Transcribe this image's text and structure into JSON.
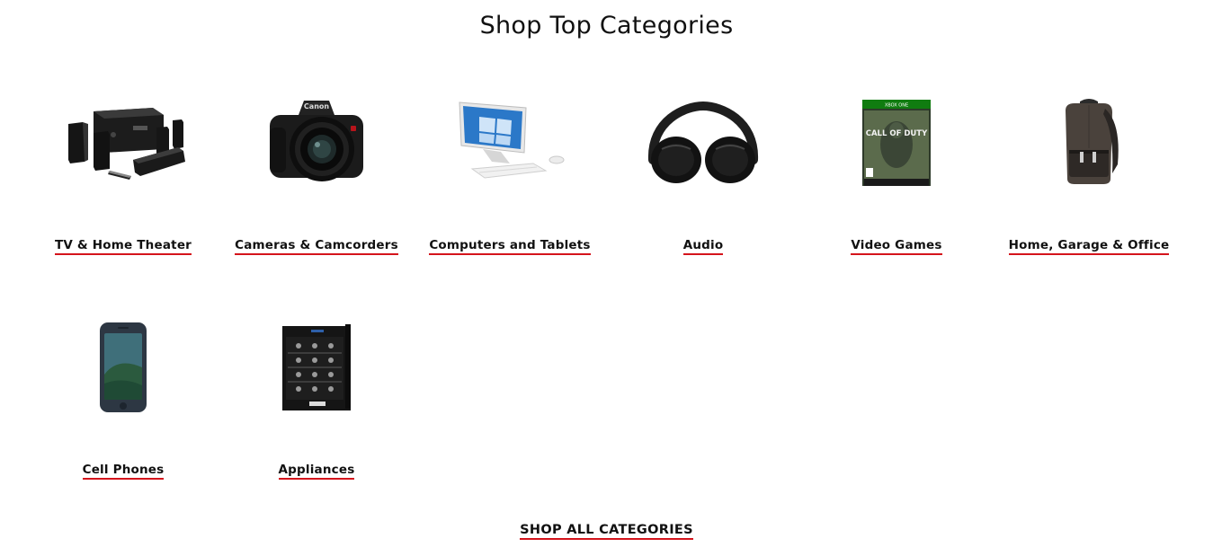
{
  "section": {
    "title": "Shop Top Categories"
  },
  "categories": [
    {
      "label": "TV & Home Theater",
      "icon": "home-theater-system"
    },
    {
      "label": "Cameras & Camcorders",
      "icon": "dslr-camera"
    },
    {
      "label": "Computers and Tablets",
      "icon": "all-in-one-computer"
    },
    {
      "label": "Audio",
      "icon": "headphones"
    },
    {
      "label": "Video Games",
      "icon": "video-game-case"
    },
    {
      "label": "Home, Garage & Office",
      "icon": "backpack"
    },
    {
      "label": "Cell Phones",
      "icon": "smartphone"
    },
    {
      "label": "Appliances",
      "icon": "wine-cooler"
    }
  ],
  "shop_all": {
    "label": "SHOP ALL CATEGORIES"
  },
  "image_text": {
    "camera_brand": "Canon",
    "game_platform": "XBOX ONE",
    "game_title": "CALL OF DUTY"
  },
  "colors": {
    "underline_accent": "#d4141c",
    "text": "#111111",
    "xbox_green": "#107c10"
  }
}
